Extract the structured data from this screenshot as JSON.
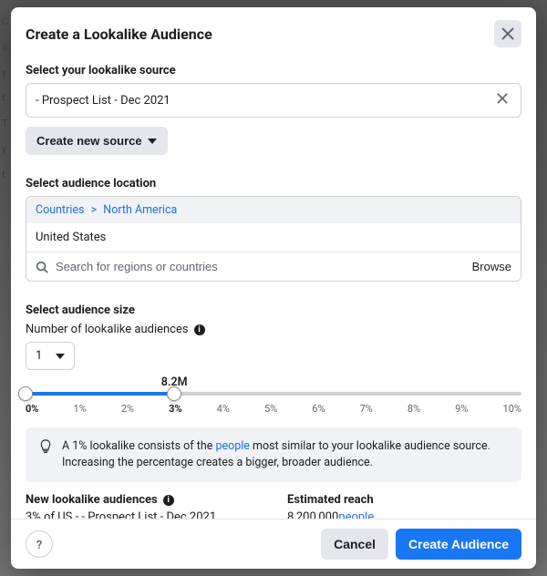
{
  "modal": {
    "title": "Create a Lookalike Audience"
  },
  "source": {
    "label": "Select your lookalike source",
    "value": "- Prospect List - Dec 2021",
    "create_new": "Create new source"
  },
  "location": {
    "label": "Select audience location",
    "breadcrumb_1": "Countries",
    "breadcrumb_2": "North America",
    "selected": "United States",
    "search_placeholder": "Search for regions or countries",
    "browse": "Browse"
  },
  "size": {
    "label": "Select audience size",
    "num_label": "Number of lookalike audiences",
    "num_value": "1",
    "slider_value": "8.2M",
    "ticks": [
      "0%",
      "1%",
      "2%",
      "3%",
      "4%",
      "5%",
      "6%",
      "7%",
      "8%",
      "9%",
      "10%"
    ],
    "active_tick_index": 3
  },
  "hint": {
    "pre": "A 1% lookalike consists of the ",
    "link": "people",
    "post": " most similar to your lookalike audience source. Increasing the percentage creates a bigger, broader audience."
  },
  "summary": {
    "audiences_label": "New lookalike audiences",
    "audiences_text_pre": "3% of US - ",
    "audiences_text_post": " - Prospect List - Dec 2021",
    "reach_label": "Estimated reach",
    "reach_value": "8,200,000",
    "reach_link": "people"
  },
  "footer": {
    "cancel": "Cancel",
    "create": "Create Audience"
  }
}
